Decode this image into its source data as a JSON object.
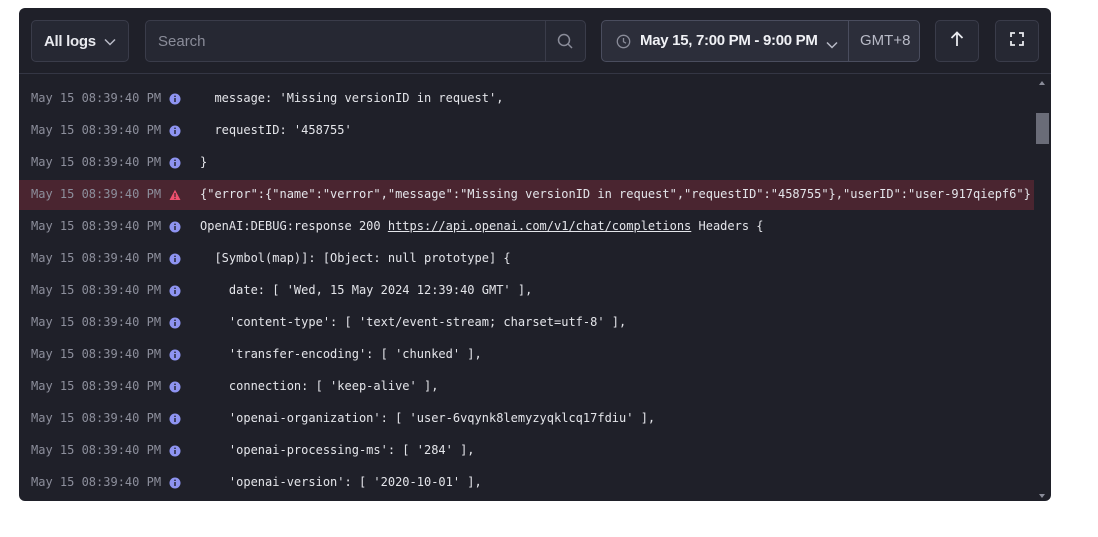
{
  "toolbar": {
    "source_label": "All logs",
    "search_placeholder": "Search",
    "time_range": "May 15, 7:00 PM - 9:00 PM",
    "timezone": "GMT+8"
  },
  "logs": [
    {
      "timestamp": "May 15 08:39:40 PM",
      "level": "info",
      "message": "  message: 'Missing versionID in request',"
    },
    {
      "timestamp": "May 15 08:39:40 PM",
      "level": "info",
      "message": "  requestID: '458755'"
    },
    {
      "timestamp": "May 15 08:39:40 PM",
      "level": "info",
      "message": "}"
    },
    {
      "timestamp": "May 15 08:39:40 PM",
      "level": "error",
      "message": "{\"error\":{\"name\":\"verror\",\"message\":\"Missing versionID in request\",\"requestID\":\"458755\"},\"userID\":\"user-917qiepf6\"}"
    },
    {
      "timestamp": "May 15 08:39:40 PM",
      "level": "info",
      "message_prefix": "OpenAI:DEBUG:response 200 ",
      "link": "https://api.openai.com/v1/chat/completions",
      "message_suffix": " Headers {"
    },
    {
      "timestamp": "May 15 08:39:40 PM",
      "level": "info",
      "message": "  [Symbol(map)]: [Object: null prototype] {"
    },
    {
      "timestamp": "May 15 08:39:40 PM",
      "level": "info",
      "message": "    date: [ 'Wed, 15 May 2024 12:39:40 GMT' ],"
    },
    {
      "timestamp": "May 15 08:39:40 PM",
      "level": "info",
      "message": "    'content-type': [ 'text/event-stream; charset=utf-8' ],"
    },
    {
      "timestamp": "May 15 08:39:40 PM",
      "level": "info",
      "message": "    'transfer-encoding': [ 'chunked' ],"
    },
    {
      "timestamp": "May 15 08:39:40 PM",
      "level": "info",
      "message": "    connection: [ 'keep-alive' ],"
    },
    {
      "timestamp": "May 15 08:39:40 PM",
      "level": "info",
      "message": "    'openai-organization': [ 'user-6vqynk8lemyzyqklcq17fdiu' ],"
    },
    {
      "timestamp": "May 15 08:39:40 PM",
      "level": "info",
      "message": "    'openai-processing-ms': [ '284' ],"
    },
    {
      "timestamp": "May 15 08:39:40 PM",
      "level": "info",
      "message": "    'openai-version': [ '2020-10-01' ],"
    }
  ],
  "icons": {
    "source_dropdown": "chevron-down-icon",
    "search": "search-icon",
    "time": "clock-icon",
    "time_dropdown": "chevron-down-icon",
    "scroll_top": "arrow-up-icon",
    "fullscreen": "fullscreen-icon",
    "info": "info-icon",
    "error": "warning-icon"
  },
  "colors": {
    "panel_bg": "#1f2029",
    "error_row_bg": "#4a2530",
    "info_icon": "#8e94f2",
    "error_icon": "#f0506e"
  }
}
